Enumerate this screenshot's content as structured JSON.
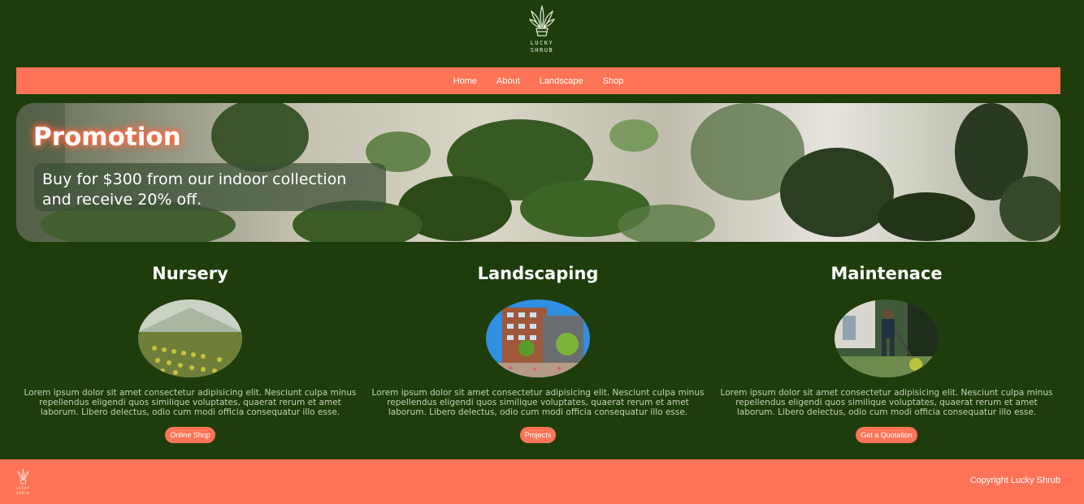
{
  "brand": {
    "logo_line1": "LUCKY",
    "logo_line2": "SHRUB"
  },
  "nav": {
    "items": [
      "Home",
      "About",
      "Landscape",
      "Shop"
    ]
  },
  "hero": {
    "title": "Promotion",
    "text": "Buy for $300 from our indoor collection and receive 20% off."
  },
  "services": [
    {
      "title": "Nursery",
      "text": "Lorem ipsum dolor sit amet consectetur adipisicing elit. Nesciunt culpa minus repellendus eligendi quos similique voluptates, quaerat rerum et amet laborum. Libero delectus, odio cum modi officia consequatur illo esse.",
      "button": "Online Shop"
    },
    {
      "title": "Landscaping",
      "text": "Lorem ipsum dolor sit amet consectetur adipisicing elit. Nesciunt culpa minus repellendus eligendi quos similique voluptates, quaerat rerum et amet laborum. Libero delectus, odio cum modi officia consequatur illo esse.",
      "button": "Projects"
    },
    {
      "title": "Maintenace",
      "text": "Lorem ipsum dolor sit amet consectetur adipisicing elit. Nesciunt culpa minus repellendus eligendi quos similique voluptates, quaerat rerum et amet laborum. Libero delectus, odio cum modi officia consequatur illo esse.",
      "button": "Get a Quotation"
    }
  ],
  "footer": {
    "copyright": "Copyright Lucky Shrub"
  },
  "colors": {
    "background": "#1f3d0c",
    "accent": "#ff7456",
    "text": "#ffffff"
  },
  "icons": {
    "logo": "shrub-logo-icon"
  }
}
